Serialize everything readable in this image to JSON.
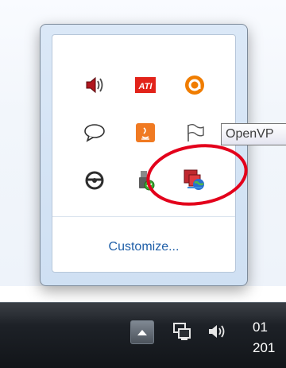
{
  "flyout": {
    "customize_label": "Customize...",
    "icons": [
      "volume-icon",
      "ati-icon",
      "avast-icon",
      "speech-bubble-icon",
      "java-icon",
      "action-center-flag-icon",
      "steering-wheel-icon",
      "safely-remove-hardware-icon",
      "openvpn-icon"
    ],
    "ati_text": "ATI"
  },
  "tooltip": {
    "text": "OpenVP"
  },
  "taskbar": {
    "clock_time": "01",
    "clock_date": "201",
    "icons": [
      "show-hidden-icons-icon",
      "network-icon",
      "taskbar-volume-icon"
    ]
  },
  "colors": {
    "link": "#1f5fa8",
    "annotation": "#e3001b",
    "taskbar": "#1d2127",
    "ati_red": "#e2231a"
  }
}
